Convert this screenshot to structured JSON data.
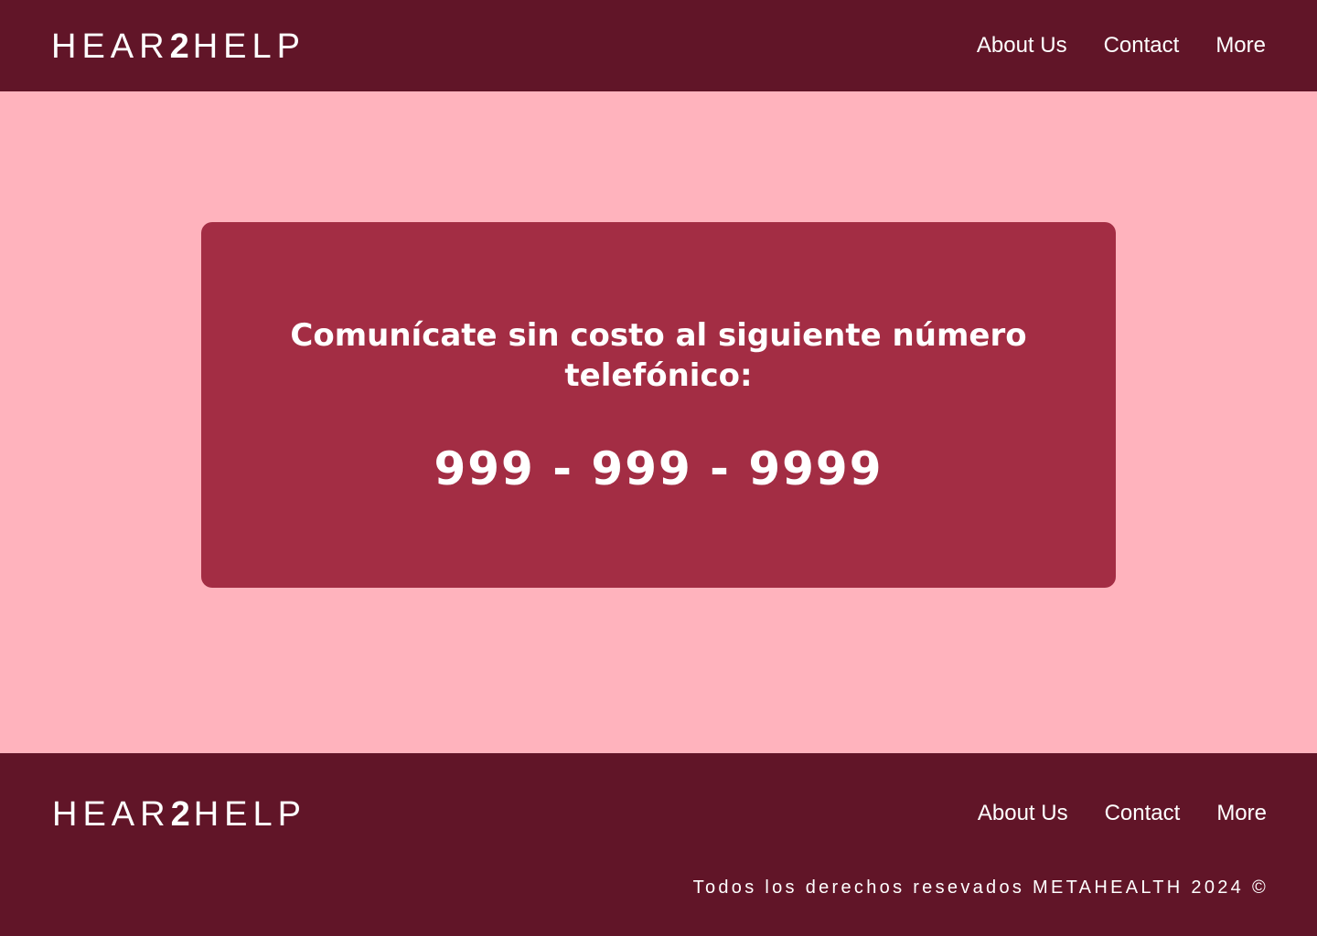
{
  "header": {
    "logo_part1": "HEAR",
    "logo_part2": "2",
    "logo_part3": "HELP",
    "nav": [
      "About Us",
      "Contact",
      "More"
    ]
  },
  "card": {
    "headline_part1": "Comunícate ",
    "headline_bold": "sin costo",
    "headline_part2": " al siguiente número telefónico:",
    "phone": "999 - 999 - 9999"
  },
  "footer": {
    "logo_part1": "HEAR",
    "logo_part2": "2",
    "logo_part3": "HELP",
    "nav": [
      "About Us",
      "Contact",
      "More"
    ],
    "copyright": "Todos los derechos resevados METAHEALTH 2024 ©"
  },
  "colors": {
    "bar": "#611528",
    "background": "#ffb3bd",
    "card": "#a32d44",
    "text": "#ffffff"
  }
}
